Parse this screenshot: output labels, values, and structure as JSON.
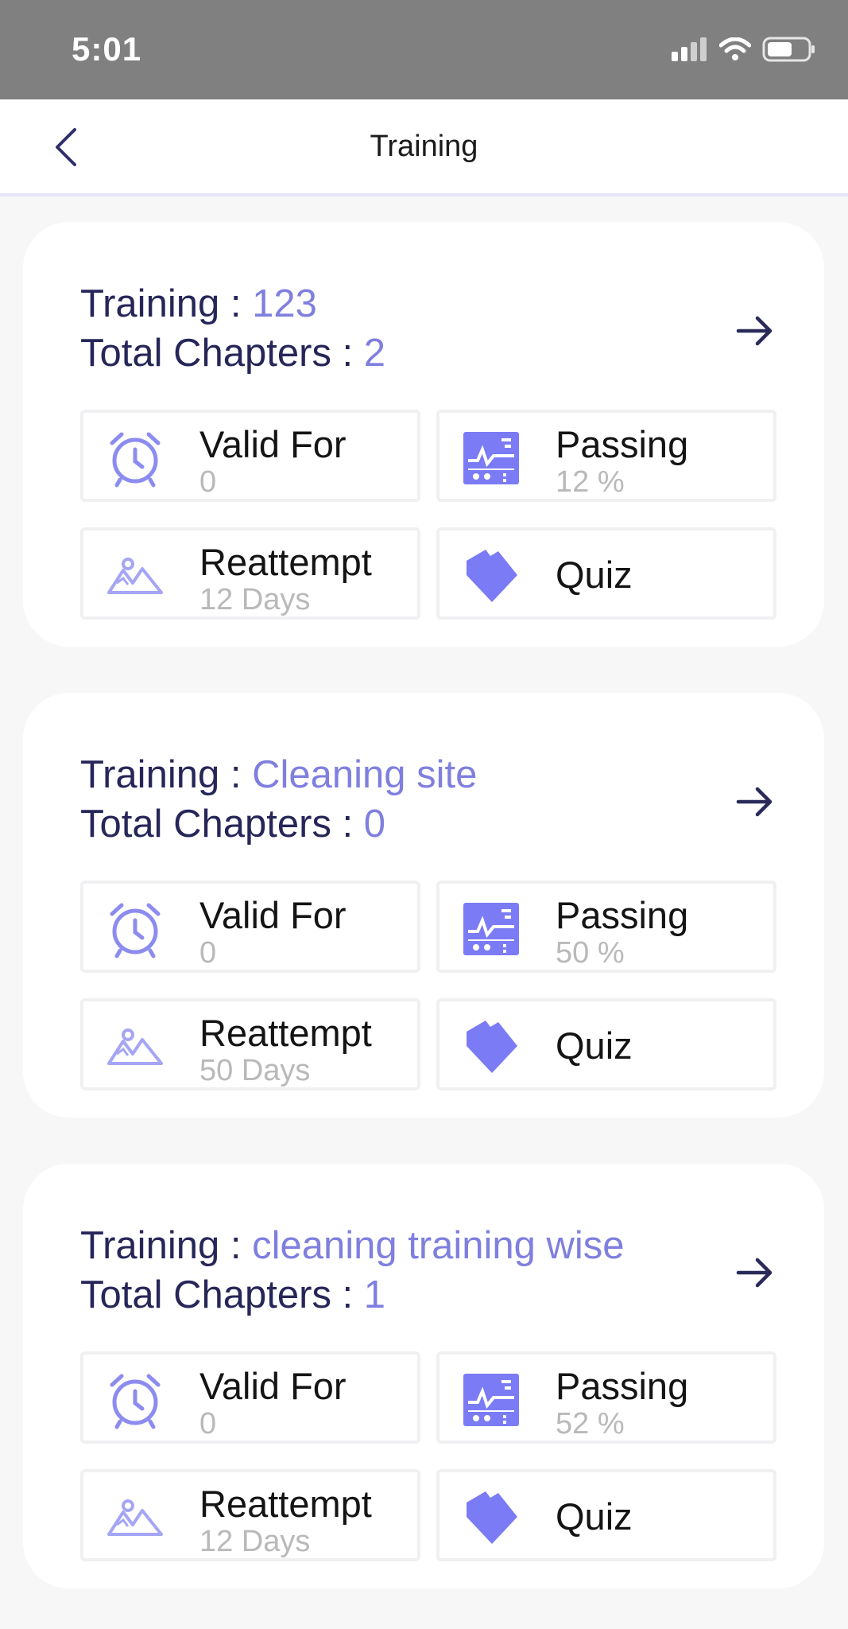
{
  "status_bar": {
    "time": "5:01"
  },
  "header": {
    "title": "Training"
  },
  "training_label": "Training : ",
  "chapters_label": "Total Chapters : ",
  "tile_labels": {
    "valid_for": "Valid For",
    "passing": "Passing",
    "reattempt": "Reattempt",
    "quiz": "Quiz"
  },
  "trainings": [
    {
      "name": "123",
      "chapters": "2",
      "valid_for": "0",
      "passing": "12 %",
      "reattempt": "12 Days"
    },
    {
      "name": "Cleaning site",
      "chapters": "0",
      "valid_for": "0",
      "passing": "50 %",
      "reattempt": "50 Days"
    },
    {
      "name": "cleaning training wise",
      "chapters": "1",
      "valid_for": "0",
      "passing": "52 %",
      "reattempt": "12 Days"
    }
  ],
  "colors": {
    "accent": "#7f7fdf",
    "icon": "#7b7bf5",
    "title_text": "#262659",
    "muted": "#b9b9b9",
    "status_bar": "#808080"
  },
  "icons": {
    "back": "chevron-left-icon",
    "open": "arrow-right-icon",
    "valid_for": "alarm-clock-icon",
    "passing": "dashboard-chart-icon",
    "reattempt": "mountain-image-icon",
    "quiz": "puzzle-diamond-icon"
  }
}
